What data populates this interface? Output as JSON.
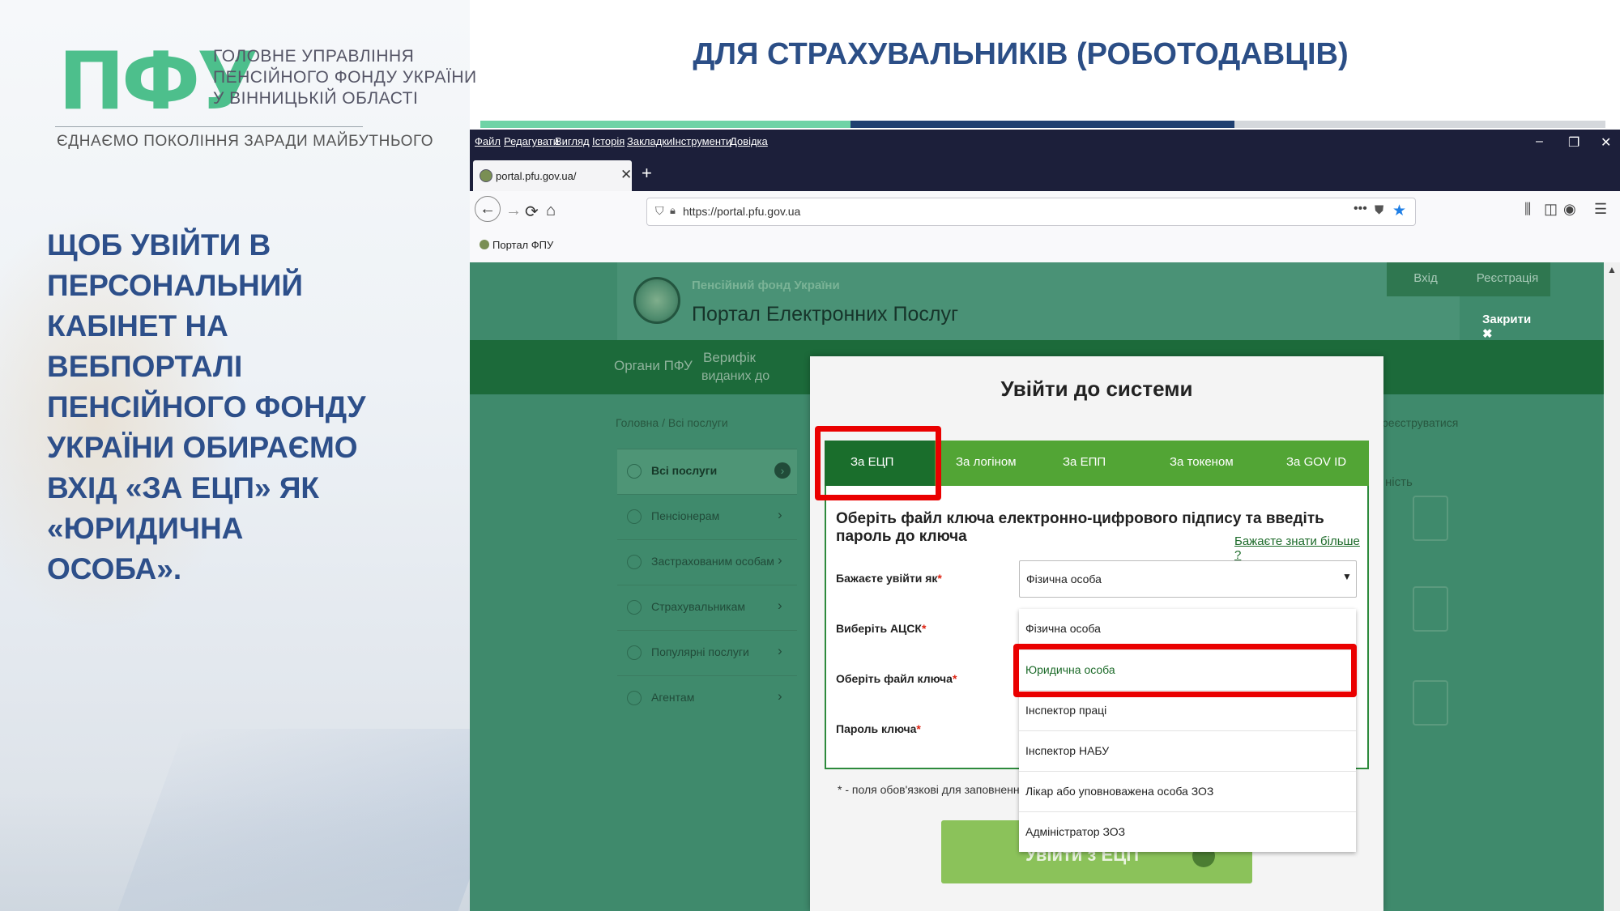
{
  "logo": {
    "abbr": "ПФУ",
    "org_line1": "ГОЛОВНЕ УПРАВЛІННЯ",
    "org_line2": "ПЕНСІЙНОГО ФОНДУ УКРАЇНИ",
    "org_line3": "У ВІННИЦЬКІЙ ОБЛАСТІ",
    "motto": "ЄДНАЄМО ПОКОЛІННЯ ЗАРАДИ МАЙБУТНЬОГО"
  },
  "slide_title": "ДЛЯ СТРАХУВАЛЬНИКІВ (РОБОТОДАВЦІВ)",
  "instruction_lines": [
    "ЩОБ УВІЙТИ  В",
    "ПЕРСОНАЛЬНИЙ",
    "КАБІНЕТ НА",
    "ВЕБПОРТАЛІ",
    "ПЕНСІЙНОГО ФОНДУ",
    "УКРАЇНИ  ОБИРАЄМО",
    "ВХІД «ЗА ЕЦП» ЯК",
    "«ЮРИДИЧНА",
    "ОСОБА»."
  ],
  "browser": {
    "menu": [
      "Файл",
      "Редагувати",
      "Вигляд",
      "Історія",
      "Закладки",
      "Інструменти",
      "Довідка"
    ],
    "window_controls": [
      "–",
      "❐",
      "✕"
    ],
    "tab_label": "portal.pfu.gov.ua/",
    "tab_close": "✕",
    "new_tab": "+",
    "url": "https://portal.pfu.gov.ua",
    "url_dots": "•••",
    "bookmark": "Портал ФПУ"
  },
  "portal": {
    "org_small": "Пенсійний фонд України",
    "name": "Портал Електронних Послуг",
    "enter": "Вхід",
    "register": "Реєстрація",
    "close": "Закрити ✖",
    "nav_organs": "Органи ПФУ",
    "nav_verif_1": "Верифік",
    "nav_verif_2": "виданих до",
    "breadcrumb": "Головна / Всі послуги",
    "right_register": "реєструватися",
    "right_text": "ність",
    "sidebar": [
      {
        "label": "Всі послуги"
      },
      {
        "label": "Пенсіонерам"
      },
      {
        "label": "Застрахованим особам"
      },
      {
        "label": "Страхувальникам"
      },
      {
        "label": "Популярні послуги"
      },
      {
        "label": "Агентам"
      }
    ]
  },
  "modal": {
    "title": "Увійти до системи",
    "tabs": [
      "За ЕЦП",
      "За логіном",
      "За ЕПП",
      "За токеном",
      "За GOV ID"
    ],
    "active_tab": "За ЕЦП",
    "heading": "Оберіть файл ключа електронно-цифрового підпису та введіть пароль до ключа",
    "learn_more": "Бажаєте знати більше",
    "fields": {
      "login_as": "Бажаєте увійти як",
      "acsk": "Виберіть АЦСК",
      "key_file": "Оберіть файл ключа",
      "password": "Пароль ключа"
    },
    "required_mark": "*",
    "select_value": "Фізична особа",
    "options": [
      "Фізична особа",
      "Юридична особа",
      "Інспектор праці",
      "Інспектор НАБУ",
      "Лікар або уповноважена особа ЗОЗ",
      "Адміністратор ЗОЗ"
    ],
    "highlighted_option": "Юридична особа",
    "required_note": "* - поля обов'язкові для заповнення",
    "submit": "Увійти з ЕЦП"
  },
  "colors": {
    "title_blue": "#2b4e86",
    "logo_green": "#4dbf8c",
    "highlight_red": "#ea0000",
    "tab_green": "#52a535",
    "tab_active": "#1a6e2c"
  }
}
